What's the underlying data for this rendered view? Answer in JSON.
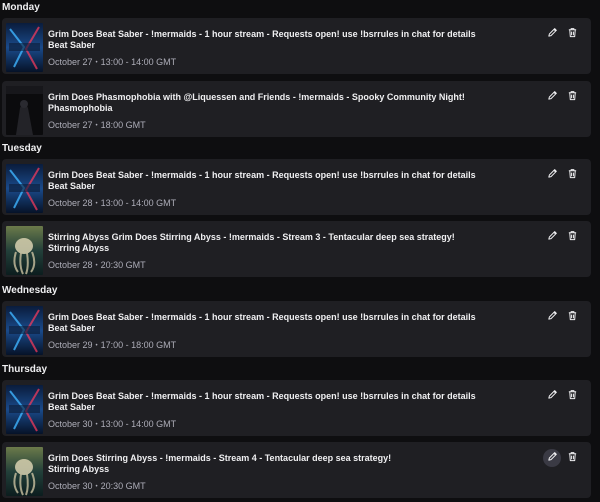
{
  "days": [
    {
      "label": "Monday",
      "events": [
        {
          "title": "Grim Does Beat Saber - !mermaids - 1 hour stream - Requests open! use !bsrrules in chat for details",
          "game": "Beat Saber",
          "date": "October 27",
          "time": "13:00 - 14:00 GMT",
          "thumb": "beatsaber",
          "thumb_text": "BEAT SABER"
        },
        {
          "title": "Grim Does Phasmophobia with @Liquessen and Friends - !mermaids - Spooky Community Night!",
          "game": "Phasmophobia",
          "date": "October 27",
          "time": "18:00 GMT",
          "thumb": "phasmo",
          "thumb_text": "PHASMOPHOBIA"
        }
      ]
    },
    {
      "label": "Tuesday",
      "events": [
        {
          "title": "Grim Does Beat Saber - !mermaids - 1 hour stream - Requests open! use !bsrrules in chat for details",
          "game": "Beat Saber",
          "date": "October 28",
          "time": "13:00 - 14:00 GMT",
          "thumb": "beatsaber",
          "thumb_text": "BEAT SABER"
        },
        {
          "title": "Stirring Abyss Grim Does Stirring Abyss - !mermaids - Stream 3 - Tentacular deep sea strategy!",
          "game": "Stirring Abyss",
          "date": "October 28",
          "time": "20:30 GMT",
          "thumb": "abyss",
          "thumb_text": ""
        }
      ]
    },
    {
      "label": "Wednesday",
      "events": [
        {
          "title": "Grim Does Beat Saber - !mermaids - 1 hour stream - Requests open! use !bsrrules in chat for details",
          "game": "Beat Saber",
          "date": "October 29",
          "time": "17:00 - 18:00 GMT",
          "thumb": "beatsaber",
          "thumb_text": "BEAT SABER"
        }
      ]
    },
    {
      "label": "Thursday",
      "events": [
        {
          "title": "Grim Does Beat Saber - !mermaids - 1 hour stream - Requests open! use !bsrrules in chat for details",
          "game": "Beat Saber",
          "date": "October 30",
          "time": "13:00 - 14:00 GMT",
          "thumb": "beatsaber",
          "thumb_text": "BEAT SABER"
        },
        {
          "title": "Grim Does Stirring Abyss - !mermaids - Stream 4 - Tentacular deep sea strategy!",
          "game": "Stirring Abyss",
          "date": "October 30",
          "time": "20:30 GMT",
          "thumb": "abyss",
          "thumb_text": ""
        }
      ]
    }
  ],
  "time_separator": "•",
  "icons": {
    "edit": "pencil-icon",
    "delete": "trash-icon"
  }
}
